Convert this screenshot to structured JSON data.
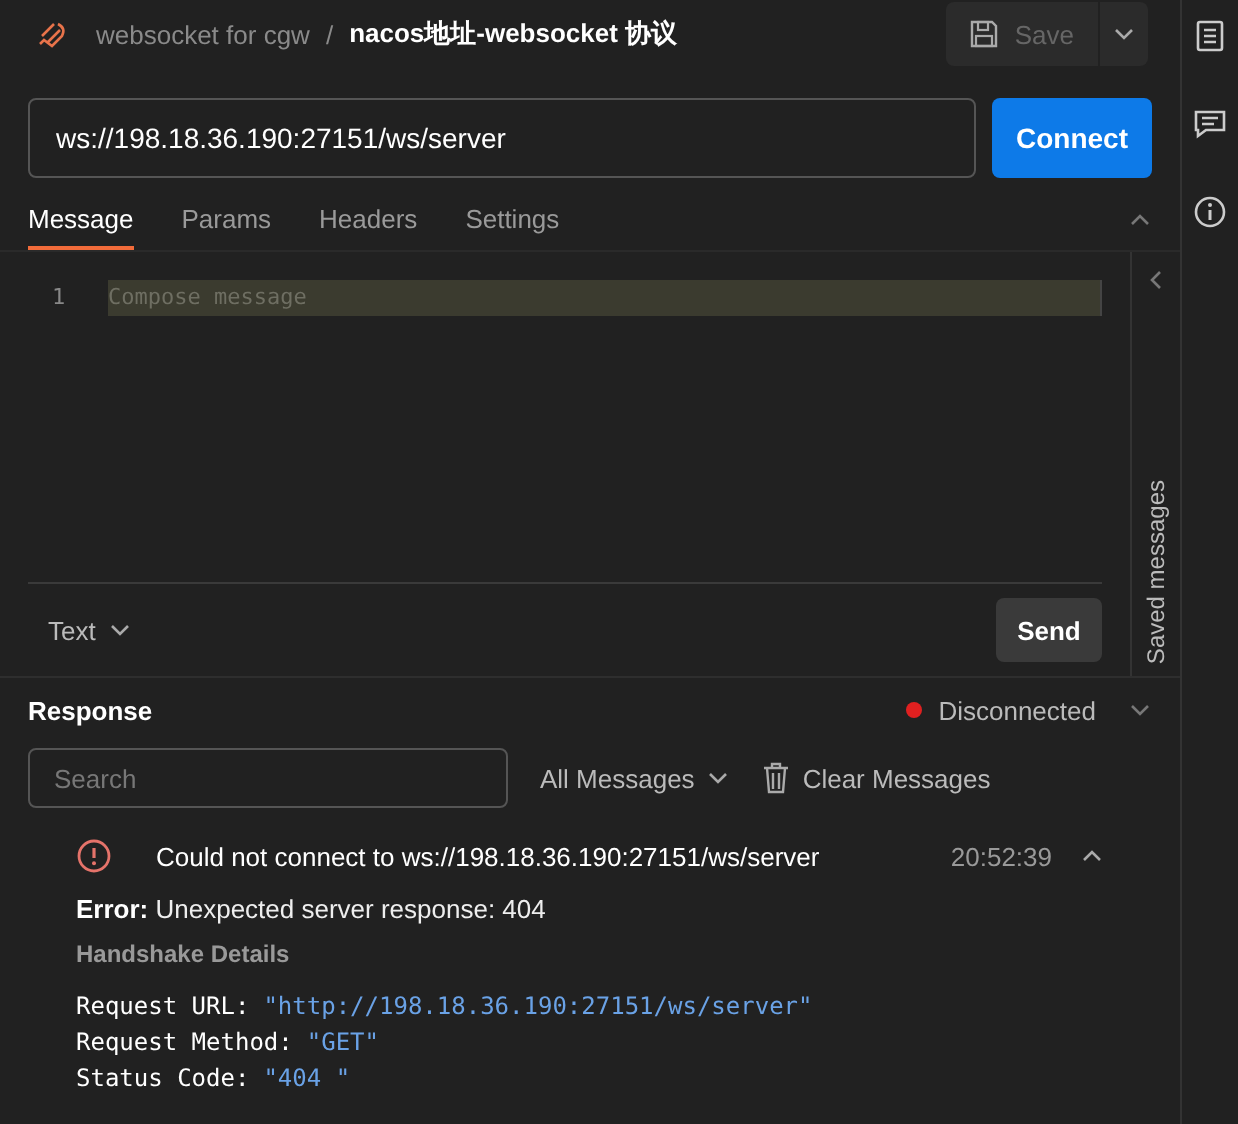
{
  "breadcrumb": {
    "collection": "websocket for cgw",
    "separator": "/",
    "title": "nacos地址-websocket 协议"
  },
  "save_button": {
    "label": "Save",
    "disabled": true
  },
  "url": {
    "value": "ws://198.18.36.190:27151/ws/server"
  },
  "connect_button": {
    "label": "Connect"
  },
  "tabs": [
    {
      "label": "Message",
      "selected": true
    },
    {
      "label": "Params",
      "selected": false
    },
    {
      "label": "Headers",
      "selected": false
    },
    {
      "label": "Settings",
      "selected": false
    }
  ],
  "editor": {
    "line_number": "1",
    "placeholder": "Compose message"
  },
  "format": {
    "label": "Text"
  },
  "send_button": {
    "label": "Send"
  },
  "saved_messages": {
    "label": "Saved messages"
  },
  "response": {
    "title": "Response",
    "status": "Disconnected",
    "connected": false,
    "search_placeholder": "Search",
    "filter": "All Messages",
    "clear": "Clear Messages"
  },
  "messages": [
    {
      "kind": "error",
      "text": "Could not connect to ws://198.18.36.190:27151/ws/server",
      "time": "20:52:39",
      "expanded": true,
      "error_label": "Error:",
      "error_text": "Unexpected server response: 404",
      "details_title": "Handshake Details",
      "details": [
        {
          "key": "Request URL:",
          "value": "\"http://198.18.36.190:27151/ws/server\""
        },
        {
          "key": "Request Method:",
          "value": "\"GET\""
        },
        {
          "key": "Status Code:",
          "value": "\"404 \""
        }
      ]
    }
  ]
}
